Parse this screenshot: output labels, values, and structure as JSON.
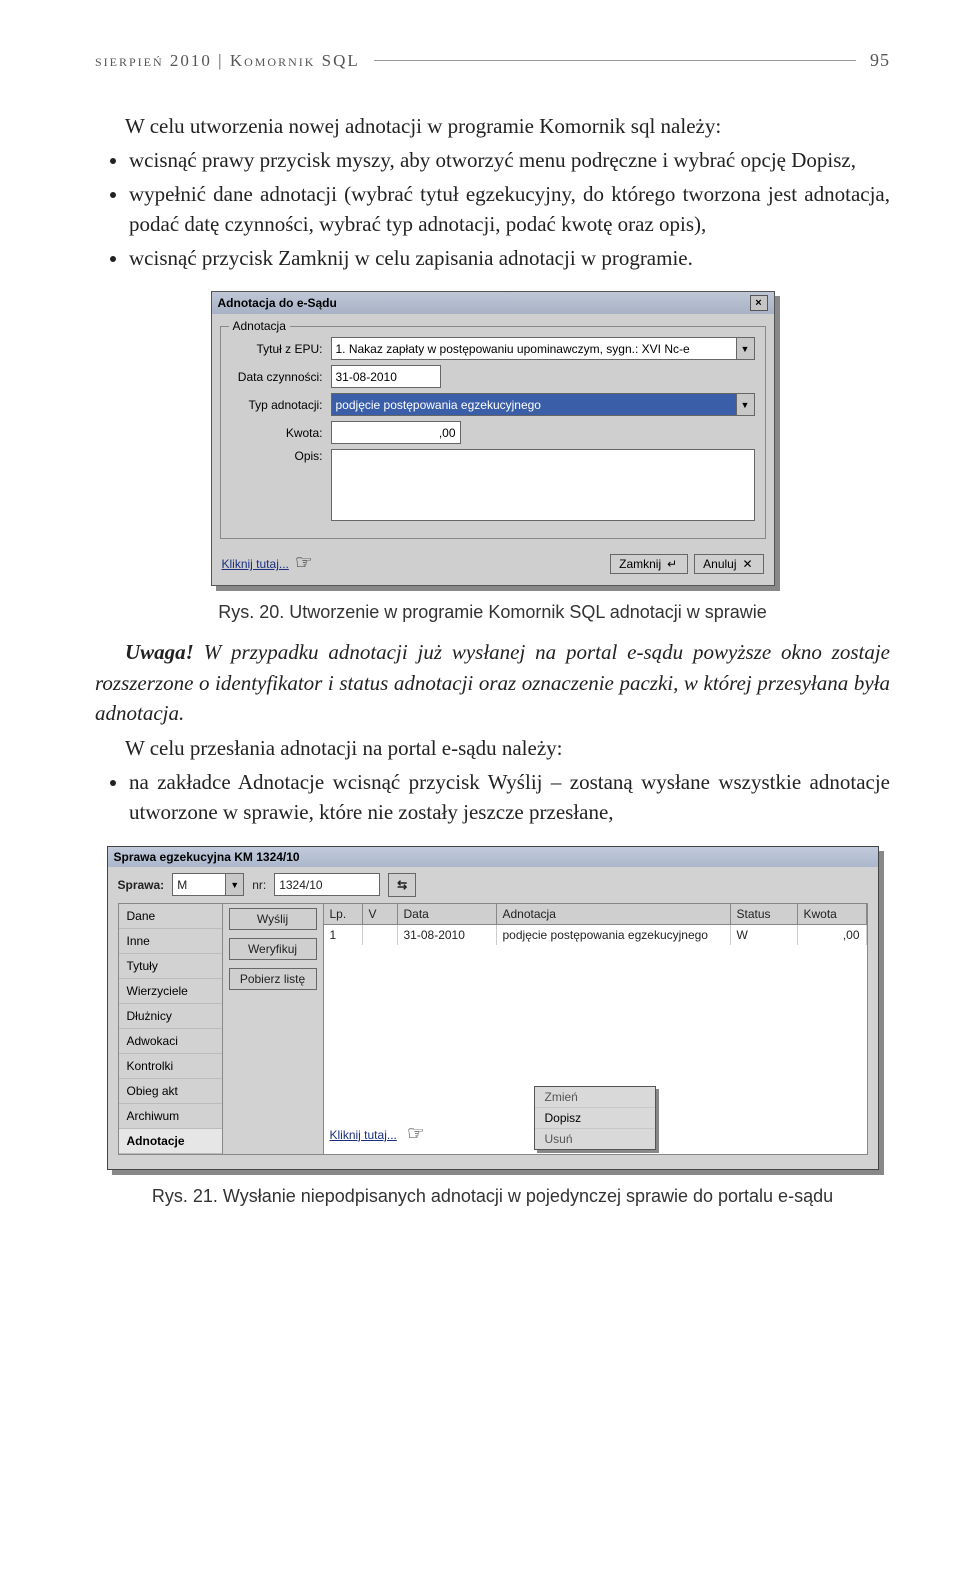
{
  "header": {
    "left": "sierpień 2010   |   Komornik SQL",
    "page": "95"
  },
  "para1": "W celu utworzenia nowej adnotacji w programie Komornik sql należy:",
  "bullets1": [
    "wcisnąć prawy przycisk myszy, aby otworzyć menu podręczne i wybrać opcję Dopisz,",
    "wypełnić dane adnotacji (wybrać tytuł egzekucyjny, do którego tworzona jest adnotacja, podać datę czynności, wybrać typ adnotacji, podać kwotę oraz opis),",
    "wcisnąć przycisk Zamknij w celu zapisania adnotacji w programie."
  ],
  "dialog1": {
    "title": "Adnotacja do e-Sądu",
    "frameLabel": "Adnotacja",
    "labels": {
      "tytul": "Tytuł z EPU:",
      "data": "Data czynności:",
      "typ": "Typ adnotacji:",
      "kwota": "Kwota:",
      "opis": "Opis:"
    },
    "values": {
      "tytul": "1. Nakaz zapłaty w postępowaniu upominawczym, sygn.: XVI Nc-e",
      "data": "31-08-2010",
      "typ": "podjęcie postępowania egzekucyjnego",
      "kwota": ",00"
    },
    "click": "Kliknij tutaj...",
    "btnZamknij": "Zamknij",
    "btnAnuluj": "Anuluj"
  },
  "caption1": "Rys. 20. Utworzenie w programie Komornik SQL adnotacji w sprawie",
  "uwagaLabel": "Uwaga!",
  "uwagaText": " W przypadku adnotacji już wysłanej na portal e-sądu powyższe okno zostaje rozszerzone o identyfikator i status adnotacji oraz oznaczenie paczki, w której przesyłana była adnotacja.",
  "para2": "W celu przesłania adnotacji na portal e-sądu należy:",
  "bullets2": [
    "na zakładce Adnotacje wcisnąć przycisk Wyślij – zostaną wysłane wszystkie adnotacje utworzone w sprawie, które nie zostały jeszcze przesłane,"
  ],
  "dialog2": {
    "title": "Sprawa egzekucyjna KM 1324/10",
    "sprawaLabel": "Sprawa:",
    "sprawaType": "M",
    "nrLabel": "nr:",
    "nrValue": "1324/10",
    "leftMenu": [
      "Dane",
      "Inne",
      "Tytuły",
      "Wierzyciele",
      "Dłużnicy",
      "Adwokaci",
      "Kontrolki",
      "Obieg akt",
      "Archiwum",
      "Adnotacje"
    ],
    "midButtons": [
      "Wyślij",
      "Weryfikuj",
      "Pobierz listę"
    ],
    "gridHead": {
      "lp": "Lp.",
      "v": "V",
      "data": "Data",
      "ad": "Adnotacja",
      "status": "Status",
      "kwota": "Kwota"
    },
    "gridRow": {
      "lp": "1",
      "v": "",
      "data": "31-08-2010",
      "ad": "podjęcie postępowania egzekucyjnego",
      "status": "W",
      "kwota": ",00"
    },
    "click": "Kliknij tutaj...",
    "popup": [
      "Zmień",
      "Dopisz",
      "Usuń"
    ]
  },
  "caption2": "Rys. 21. Wysłanie niepodpisanych adnotacji w pojedynczej sprawie do portalu e-sądu"
}
